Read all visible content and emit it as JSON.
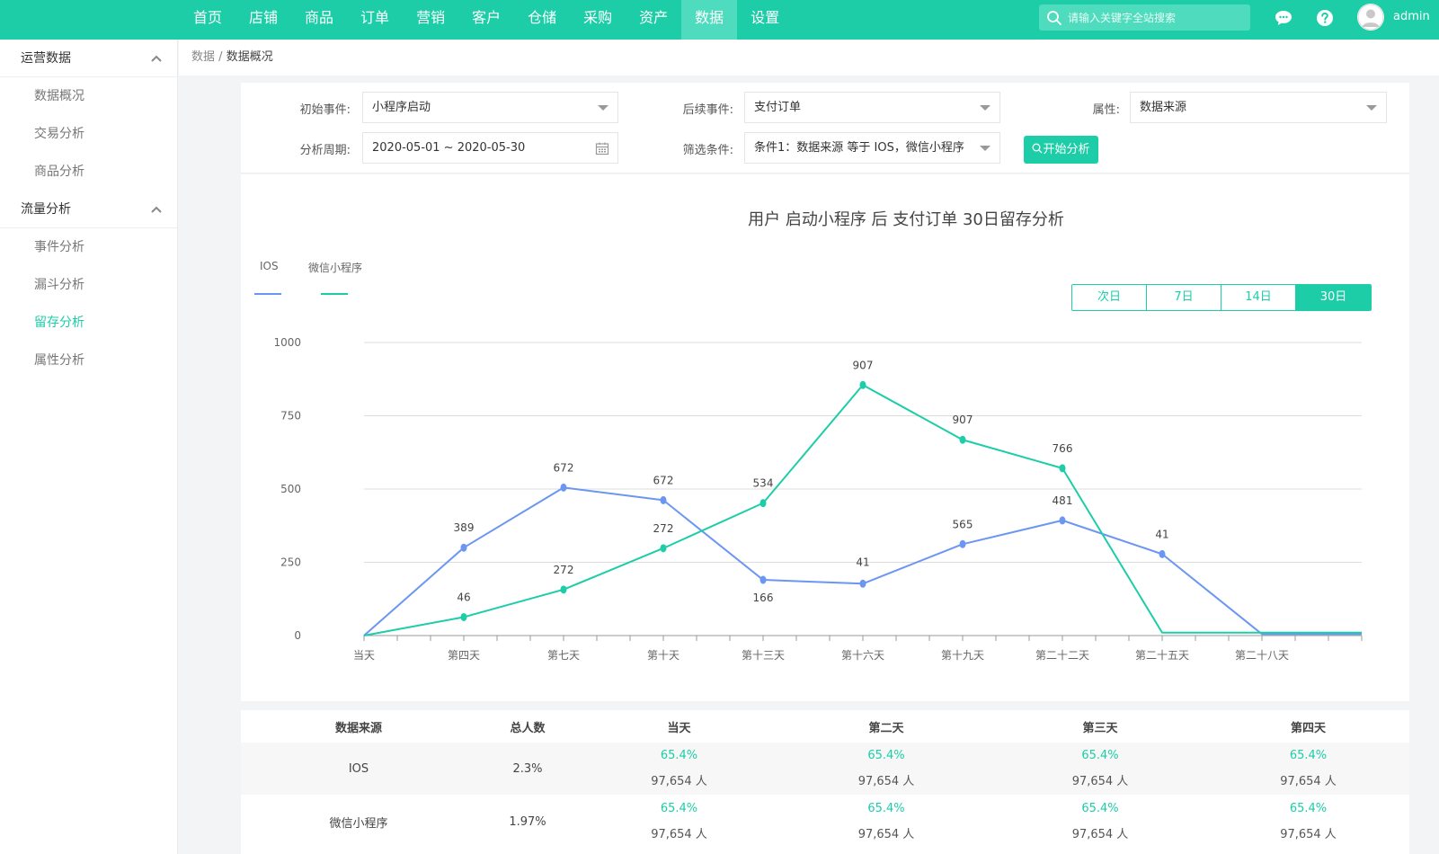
{
  "nav": {
    "items": [
      "首页",
      "店铺",
      "商品",
      "订单",
      "营销",
      "客户",
      "仓储",
      "采购",
      "资产",
      "数据",
      "设置"
    ],
    "active_index": 9,
    "search_placeholder": "请输入关键字全站搜索",
    "username": "admin"
  },
  "sidebar": {
    "group1": "运营数据",
    "group1_items": [
      "数据概况",
      "交易分析",
      "商品分析"
    ],
    "group2": "流量分析",
    "group2_items": [
      "事件分析",
      "漏斗分析",
      "留存分析",
      "属性分析"
    ],
    "active_item": "留存分析"
  },
  "breadcrumb": {
    "root": "数据",
    "sep": "/",
    "current": "数据概况"
  },
  "filters": {
    "initial_event_label": "初始事件:",
    "initial_event_value": "小程序启动",
    "follow_event_label": "后续事件:",
    "follow_event_value": "支付订单",
    "attribute_label": "属性:",
    "attribute_value": "数据来源",
    "period_label": "分析周期:",
    "period_value": "2020-05-01 ~ 2020-05-30",
    "condition_label": "筛选条件:",
    "condition_value": "条件1：数据来源 等于 IOS，微信小程序",
    "analyze_button": "开始分析"
  },
  "range_tabs": {
    "items": [
      "次日",
      "7日",
      "14日",
      "30日"
    ],
    "active_index": 3
  },
  "colors": {
    "accent": "#1ccda8",
    "ios": "#6b96f2",
    "wechat": "#1ccda8"
  },
  "chart_data": {
    "type": "line",
    "title": "用户 启动小程序 后 支付订单 30日留存分析",
    "categories": [
      "当天",
      "第四天",
      "第七天",
      "第十天",
      "第十三天",
      "第十六天",
      "第十九天",
      "第二十二天",
      "第二十五天",
      "第二十八天",
      ""
    ],
    "y_ticks": [
      0,
      250,
      500,
      750,
      1000
    ],
    "ylim": [
      0,
      1000
    ],
    "grid": true,
    "legend_position": "top-left",
    "series": [
      {
        "name": "IOS",
        "color": "#6b96f2",
        "values": [
          0,
          300,
          505,
          462,
          190,
          177,
          312,
          393,
          278,
          5,
          5
        ],
        "labels": [
          "",
          "389",
          "672",
          "672",
          "166",
          "41",
          "565",
          "481",
          "41",
          "",
          ""
        ]
      },
      {
        "name": "微信小程序",
        "color": "#1ccda8",
        "values": [
          0,
          63,
          157,
          298,
          452,
          855,
          668,
          571,
          10,
          10,
          10
        ],
        "labels": [
          "",
          "46",
          "272",
          "272",
          "534",
          "907",
          "907",
          "766",
          "",
          "",
          ""
        ]
      }
    ]
  },
  "table": {
    "headers": [
      "数据来源",
      "总人数",
      "当天",
      "第二天",
      "第三天",
      "第四天"
    ],
    "rows": [
      {
        "source": "IOS",
        "total": "2.3%",
        "cells": [
          {
            "pct": "65.4%",
            "cnt": "97,654 人"
          },
          {
            "pct": "65.4%",
            "cnt": "97,654 人"
          },
          {
            "pct": "65.4%",
            "cnt": "97,654 人"
          },
          {
            "pct": "65.4%",
            "cnt": "97,654 人"
          }
        ]
      },
      {
        "source": "微信小程序",
        "total": "1.97%",
        "cells": [
          {
            "pct": "65.4%",
            "cnt": "97,654 人"
          },
          {
            "pct": "65.4%",
            "cnt": "97,654 人"
          },
          {
            "pct": "65.4%",
            "cnt": "97,654 人"
          },
          {
            "pct": "65.4%",
            "cnt": "97,654 人"
          }
        ]
      }
    ]
  }
}
